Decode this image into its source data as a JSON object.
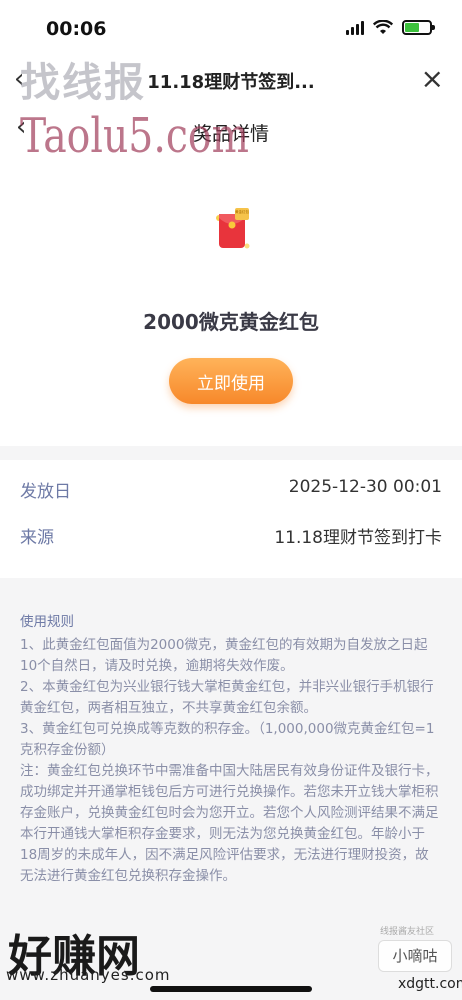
{
  "status_bar": {
    "time": "00:06"
  },
  "browser": {
    "title": "11.18理财节签到..."
  },
  "page": {
    "title": "奖品详情"
  },
  "prize": {
    "icon_text": "黄金红包",
    "name": "2000微克黄金红包",
    "button": "立即使用"
  },
  "info": {
    "issue_label": "发放日",
    "issue_value": "2025-12-30 00:01",
    "source_label": "来源",
    "source_value": "11.18理财节签到打卡"
  },
  "rules": {
    "title": "使用规则",
    "items": [
      "1、此黄金红包面值为2000微克，黄金红包的有效期为自发放之日起10个自然日，请及时兑换，逾期将失效作废。",
      "2、本黄金红包为兴业银行钱大掌柜黄金红包，并非兴业银行手机银行黄金红包，两者相互独立，不共享黄金红包余额。",
      "3、黄金红包可兑换成等克数的积存金。（1,000,000微克黄金红包=1克积存金份额）",
      "注：黄金红包兑换环节中需准备中国大陆居民有效身份证件及银行卡，成功绑定并开通掌柜钱包后方可进行兑换操作。若您未开立钱大掌柜积存金账户，兑换黄金红包时会为您开立。若您个人风险测评结果不满足本行开通钱大掌柜积存金要求，则无法为您兑换黄金红包。年龄小于18周岁的未成年人，因不满足风险评估要求，无法进行理财投资，故无法进行黄金红包兑换积存金操作。"
    ]
  },
  "watermarks": {
    "top": "找线报",
    "taolu": "Taolu5.com",
    "bottom": "好赚网",
    "bottom_url": "www.zhuanyes.com",
    "xdg_label": "线报酱友社区",
    "xdg_name": "小嘀咕",
    "xdg_url": "xdgtt.com"
  }
}
